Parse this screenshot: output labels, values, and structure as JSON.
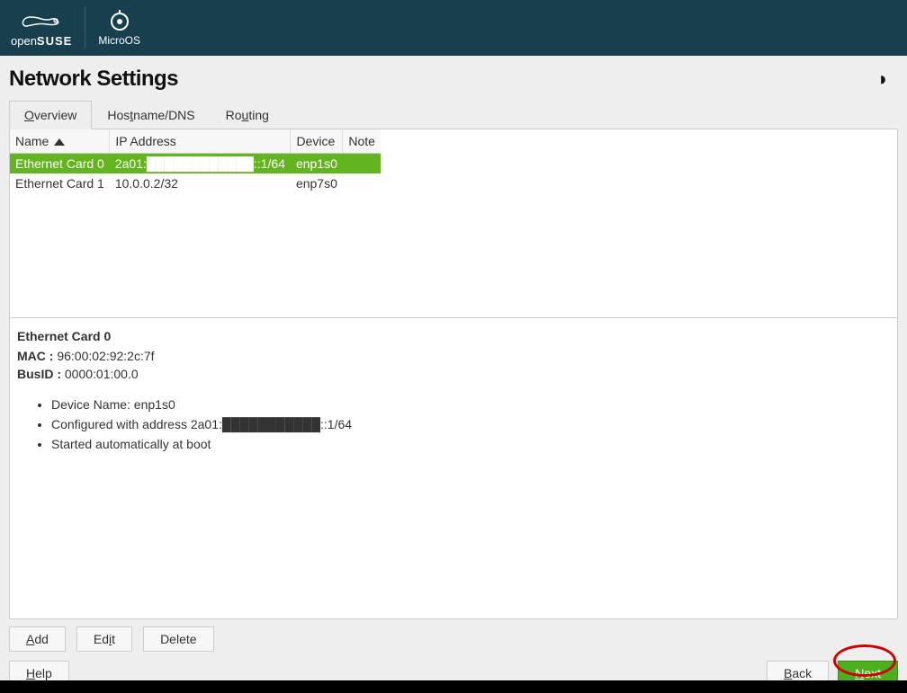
{
  "header": {
    "brand": "openSUSE",
    "product": "MicroOS"
  },
  "page": {
    "title": "Network Settings"
  },
  "tabs": {
    "overview": "Overview",
    "hostname": "Hostname/DNS",
    "routing": "Routing"
  },
  "columns": {
    "name": "Name",
    "ip": "IP Address",
    "device": "Device",
    "note": "Note"
  },
  "nics": [
    {
      "name": "Ethernet Card 0",
      "ip": "2a01:████████████::1/64",
      "device": "enp1s0",
      "note": ""
    },
    {
      "name": "Ethernet Card 1",
      "ip": "10.0.0.2/32",
      "device": "enp7s0",
      "note": ""
    }
  ],
  "detail": {
    "card_title": "Ethernet Card 0",
    "mac_label": "MAC :",
    "mac": "96:00:02:92:2c:7f",
    "busid_label": "BusID :",
    "busid": "0000:01:00.0",
    "lines": [
      "Device Name: enp1s0",
      "Configured with address 2a01:███████████::1/64",
      "Started automatically at boot"
    ]
  },
  "buttons": {
    "add": "Add",
    "edit": "Edit",
    "delete": "Delete",
    "help": "Help",
    "back": "Back",
    "next": "Next"
  }
}
